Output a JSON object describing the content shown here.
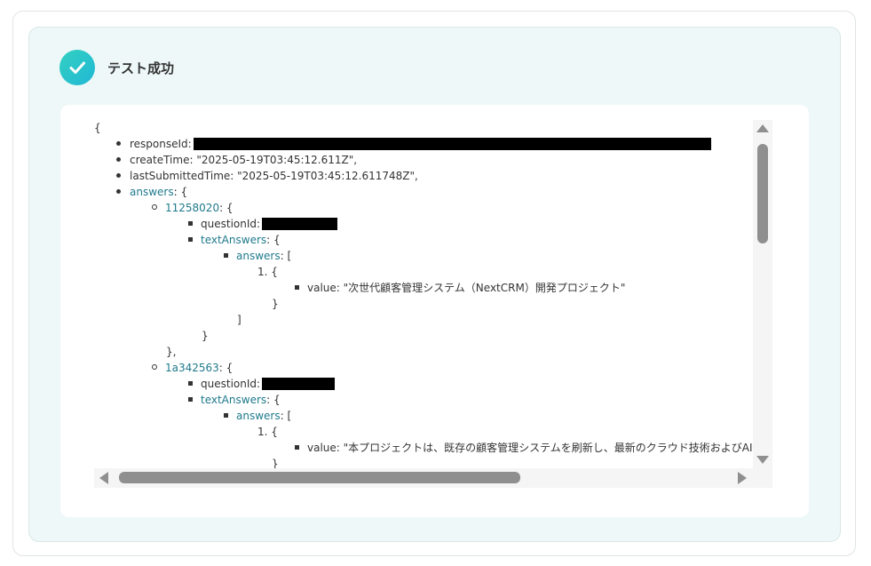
{
  "header": {
    "title": "テスト成功",
    "icon": "check-icon"
  },
  "json_viewer": {
    "open_brace": "{",
    "response_id_label": "responseId:",
    "create_time": "createTime: \"2025-05-19T03:45:12.611Z\",",
    "last_submitted_time": "lastSubmittedTime: \"2025-05-19T03:45:12.611748Z\",",
    "answers_key": "answers",
    "answers_suffix": ": {",
    "entries": [
      {
        "id": "11258020",
        "suffix": ": {",
        "question_label": "questionId:",
        "text_answers_key": "textAnswers",
        "text_answers_suffix": ": {",
        "answers_key": "answers",
        "answers_suffix": ": [",
        "item_number": "1. {",
        "value": "value: \"次世代顧客管理システム（NextCRM）開発プロジェクト\"",
        "close_item": "}",
        "close_array": "]",
        "close_text_answers": "}",
        "close_entry": "},"
      },
      {
        "id": "1a342563",
        "suffix": ": {",
        "question_label": "questionId:",
        "text_answers_key": "textAnswers",
        "text_answers_suffix": ": {",
        "answers_key": "answers",
        "answers_suffix": ": [",
        "item_number": "1. {",
        "value": "value: \"本プロジェクトは、既存の顧客管理システムを刷新し、最新のクラウド技術およびAI分",
        "close_item": "}"
      }
    ]
  },
  "colors": {
    "accent": "#20b8d6",
    "link_key": "#1f7a8c",
    "panel_bg": "#eef8f8"
  }
}
